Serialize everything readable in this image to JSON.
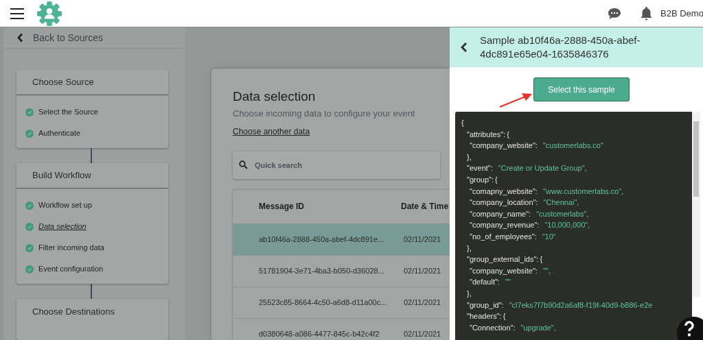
{
  "header": {
    "account": "B2B Demo"
  },
  "sidebar": {
    "back_link": "Back to Sources",
    "groups": [
      {
        "title": "Choose Source",
        "steps": [
          {
            "label": "Select the Source",
            "done": true,
            "current": false
          },
          {
            "label": "Authenticate",
            "done": true,
            "current": false
          }
        ]
      },
      {
        "title": "Build Workflow",
        "steps": [
          {
            "label": "Workflow set up",
            "done": true,
            "current": false
          },
          {
            "label": "Data selection",
            "done": true,
            "current": true
          },
          {
            "label": "Filter incoming data",
            "done": true,
            "current": false
          },
          {
            "label": "Event configuration",
            "done": true,
            "current": false
          }
        ]
      },
      {
        "title": "Choose Destinations"
      }
    ]
  },
  "main": {
    "title": "Data selection",
    "subtitle": "Choose incoming data to configure your event",
    "link": "Choose another data",
    "search": {
      "placeholder": "Quick search"
    },
    "table": {
      "columns": [
        "Message ID",
        "Date & Time"
      ],
      "rows": [
        {
          "cells": [
            "ab10f46a-2888-450a-abef-4dc891e...",
            "02/11/2021"
          ],
          "selected": true
        },
        {
          "cells": [
            "51781904-3e71-4ba3-b050-d36028...",
            "02/11/2021"
          ],
          "selected": false
        },
        {
          "cells": [
            "25523c85-8664-4c50-a6d8-d11a00c...",
            "02/11/2021"
          ],
          "selected": false
        },
        {
          "cells": [
            "d0380648-a086-4477-845c-b42c4f2",
            "02/11/2021"
          ],
          "selected": false
        }
      ]
    }
  },
  "panel": {
    "title": "Sample ab10f46a-2888-450a-abef-4dc891e65e04-1635846376",
    "button": "Select this sample",
    "code": [
      {
        "kind": "open",
        "text": "{",
        "children": [
          {
            "kind": "open",
            "key": "\"attributes\":",
            "text": "{",
            "children": [
              {
                "kind": "pair",
                "key": "\"company_website\":",
                "text": "\"customerlabs.co\""
              }
            ]
          },
          {
            "kind": "close",
            "text": "},"
          },
          {
            "kind": "pair",
            "key": "\"event\":",
            "text": "\"Create or Update Group\","
          },
          {
            "kind": "open",
            "key": "\"group\":",
            "text": "{",
            "children": [
              {
                "kind": "pair",
                "key": "\"comapny_website\":",
                "text": "\"www.customerlabs.co\","
              },
              {
                "kind": "pair",
                "key": "\"company_location\":",
                "text": "\"Chennai\","
              },
              {
                "kind": "pair",
                "key": "\"company_name\":",
                "text": "\"customerlabs\","
              },
              {
                "kind": "pair",
                "key": "\"company_revenue\":",
                "text": "\"10,000,000\","
              },
              {
                "kind": "pair",
                "key": "\"no_of_employees\":",
                "text": "\"10\""
              }
            ]
          },
          {
            "kind": "close",
            "text": "},"
          },
          {
            "kind": "open",
            "key": "\"group_external_ids\":",
            "text": "{",
            "children": [
              {
                "kind": "pair",
                "key": "\"company_website\":",
                "text": "\"\","
              },
              {
                "kind": "pair",
                "key": "\"default\":",
                "text": "\"\""
              }
            ]
          },
          {
            "kind": "close",
            "text": "},"
          },
          {
            "kind": "pair",
            "key": "\"group_id\":",
            "text": "\"cl7eks7f7b90d2a6af8-f19f-40d9-b886-e2e"
          },
          {
            "kind": "open",
            "key": "\"headers\":",
            "text": "{",
            "children": [
              {
                "kind": "pair",
                "key": "\"Connection\":",
                "text": "\"upgrade\","
              }
            ]
          }
        ]
      }
    ]
  }
}
